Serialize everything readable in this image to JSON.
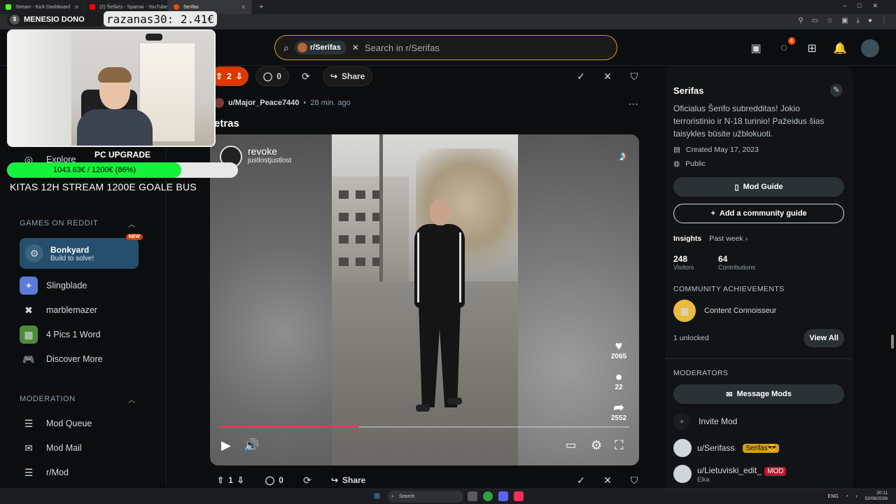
{
  "browser": {
    "tabs": [
      {
        "label": "Stream - Kick Dashboard",
        "color": "#53fc18"
      },
      {
        "label": "(2) Šeškės - Spamai - YouTube",
        "color": "#ff0000"
      },
      {
        "label": "Serifas",
        "color": "#ff4500"
      }
    ],
    "new_tab": "+"
  },
  "header": {
    "search_chip": "r/Serifas",
    "search_placeholder": "Search in r/Serifas",
    "notif_count": "4"
  },
  "overlay": {
    "dono_label": "MENESIO DONO",
    "dono_last": "razanas30: 2.41€",
    "goal_title": "PC UPGRADE",
    "goal_text": "1043.63€ / 1200€ (86%)",
    "goal_progress": 0.86,
    "goal_note": "KITAS 12H STREAM 1200E GOALE BUS"
  },
  "leftnav": {
    "explore": "Explore",
    "games_section": "GAMES ON REDDIT",
    "bonkyard": {
      "title": "Bonkyard",
      "subtitle": "Build to solve!",
      "tag": "NEW"
    },
    "games": [
      "Slingblade",
      "marblemazer",
      "4 Pics 1 Word",
      "Discover More"
    ],
    "moderation_section": "MODERATION",
    "mod_items": [
      "Mod Queue",
      "Mod Mail",
      "r/Mod"
    ]
  },
  "post": {
    "votes": "2",
    "comments": "0",
    "share": "Share",
    "author": "u/Major_Peace7440",
    "time": "28 min. ago",
    "title": "etras",
    "video": {
      "handle": "revoke",
      "subhandle": "justlostjustlost",
      "likes": "2065",
      "comments": "22",
      "shares": "2552",
      "progress": 0.34
    }
  },
  "post2": {
    "votes": "1",
    "comments": "0",
    "share": "Share"
  },
  "sidebar": {
    "name": "Serifas",
    "description": "Oficialus Šerifo subredditas! Jokio terroristinio ir N-18 turinio! Pažeidus šias taisykles būsite užblokuoti.",
    "created": "Created May 17, 2023",
    "visibility": "Public",
    "mod_guide": "Mod Guide",
    "add_guide": "Add a community guide",
    "insights": "Insights",
    "insights_period": "Past week",
    "visitors_value": "248",
    "visitors_label": "Visitors",
    "contrib_value": "64",
    "contrib_label": "Contributions",
    "achievements_section": "COMMUNITY ACHIEVEMENTS",
    "achievement": "Content Connoisseur",
    "unlocked": "1 unlocked",
    "view_all": "View All",
    "moderators_section": "MODERATORS",
    "message_mods": "Message Mods",
    "invite_mod": "Invite Mod",
    "mods": [
      {
        "name": "u/Serifass",
        "flair": "Serifas😎",
        "sub": ""
      },
      {
        "name": "u/Lietuviski_edit_",
        "flair": "MOD",
        "sub": "Elka"
      }
    ]
  },
  "taskbar": {
    "search": "Search",
    "lang": "ENG",
    "time": "20:11",
    "date": "02/08/2026"
  }
}
